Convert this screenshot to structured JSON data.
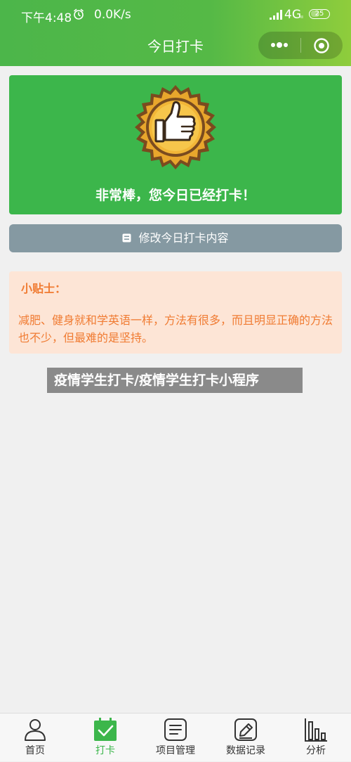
{
  "status_bar": {
    "time": "下午4:48",
    "speed": "0.0K/s",
    "network": "4G",
    "network_sub": "ıı",
    "battery": "25"
  },
  "nav": {
    "title": "今日打卡"
  },
  "banner": {
    "message": "非常棒，您今日已经打卡！",
    "icon": "thumbs-up-badge-icon"
  },
  "edit_button": {
    "label": "修改今日打卡内容",
    "icon": "edit-icon"
  },
  "tips": {
    "title": "小贴士：",
    "body": "减肥、健身就和学英语一样，方法有很多，而且明显正确的方法也不少，但最难的是坚持。"
  },
  "watermark": {
    "text": "疫情学生打卡/疫情学生打卡小程序"
  },
  "tabbar": {
    "items": [
      {
        "label": "首页",
        "icon": "user-icon"
      },
      {
        "label": "打卡",
        "icon": "checkin-icon",
        "active": true
      },
      {
        "label": "项目管理",
        "icon": "list-icon"
      },
      {
        "label": "数据记录",
        "icon": "pencil-record-icon"
      },
      {
        "label": "分析",
        "icon": "bar-chart-icon"
      }
    ]
  },
  "colors": {
    "header_green": "#4cb64a",
    "banner_green": "#3cb64b",
    "button_gray": "#8599a2",
    "tips_bg": "#fde5d6",
    "tips_text": "#f07b32",
    "badge_gold": "#e8a62c"
  }
}
